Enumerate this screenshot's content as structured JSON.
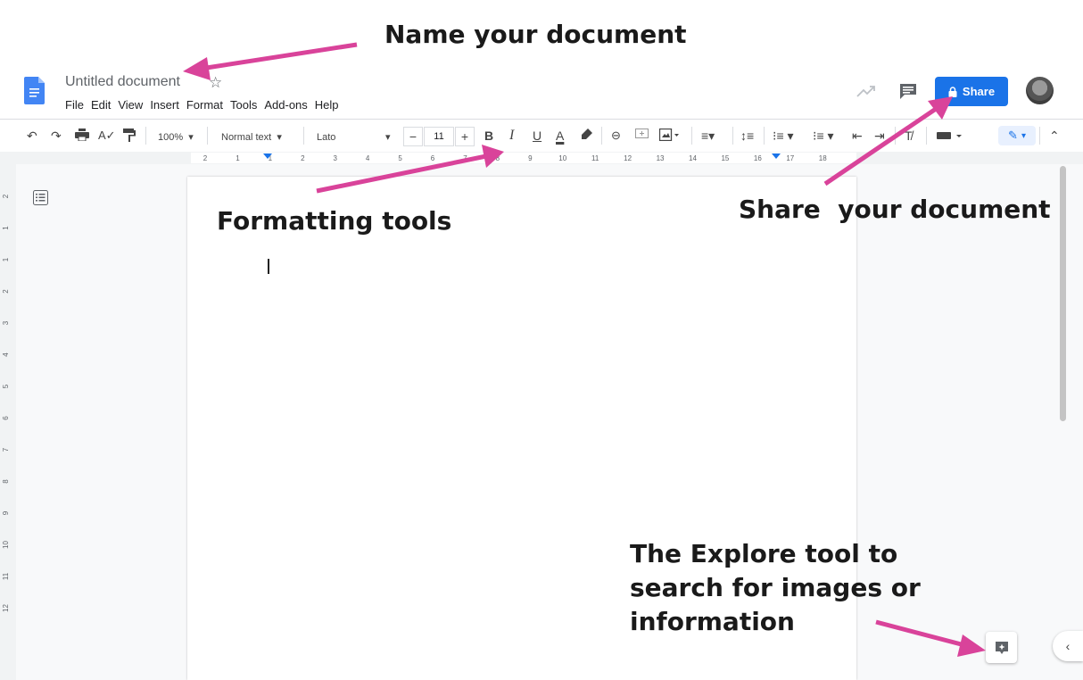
{
  "document": {
    "title": "Untitled document"
  },
  "menu": [
    "File",
    "Edit",
    "View",
    "Insert",
    "Format",
    "Tools",
    "Add-ons",
    "Help"
  ],
  "header": {
    "share_label": "Share",
    "accent_color": "#1a73e8"
  },
  "toolbar": {
    "zoom": "100%",
    "style": "Normal text",
    "font": "Lato",
    "font_size": "11",
    "bold": "B",
    "italic": "I",
    "underline": "U",
    "text_color": "A"
  },
  "ruler": {
    "labels": [
      "2",
      "1",
      "1",
      "2",
      "3",
      "4",
      "5",
      "6",
      "7",
      "8",
      "9",
      "10",
      "11",
      "12",
      "13",
      "14",
      "15",
      "16",
      "17",
      "18"
    ],
    "vertical_labels": [
      "2",
      "1",
      "1",
      "2",
      "3",
      "4",
      "5",
      "6",
      "7",
      "8",
      "9",
      "10",
      "11",
      "12"
    ]
  },
  "annotations": {
    "name": "Name your document",
    "formatting": "Formatting tools",
    "share": "Share  your document",
    "explore_line1": "The Explore tool to",
    "explore_line2": "search for images or",
    "explore_line3": "information",
    "arrow_color": "#d9439a"
  },
  "icons": [
    "docs-logo-icon",
    "star-icon",
    "trending-icon",
    "comment-icon",
    "lock-icon",
    "undo-icon",
    "redo-icon",
    "print-icon",
    "spellcheck-icon",
    "paint-format-icon",
    "highlight-icon",
    "link-icon",
    "insert-comment-icon",
    "image-icon",
    "align-icon",
    "line-spacing-icon",
    "numbered-list-icon",
    "bulleted-list-icon",
    "decrease-indent-icon",
    "increase-indent-icon",
    "clear-format-icon",
    "input-tools-icon",
    "pen-icon",
    "collapse-icon",
    "outline-icon",
    "explore-icon"
  ]
}
